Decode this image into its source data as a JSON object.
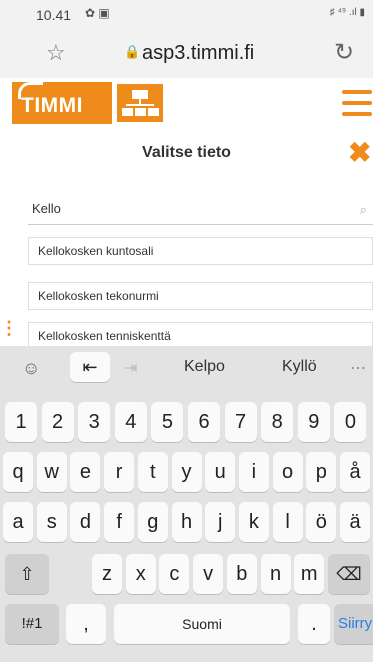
{
  "status": {
    "time": "10.41",
    "left_icons": "✿ ▣",
    "right_icons": "♯ ⁴⁹ .ıl ▮"
  },
  "browser": {
    "url": "asp3.timmi.fi"
  },
  "app": {
    "logo_text": "TIMMI",
    "accent": "#ef8b1a"
  },
  "dialog": {
    "title": "Valitse tieto",
    "search_value": "Kello",
    "options": [
      "Kellokosken kuntosali",
      "Kellokosken tekonurmi",
      "Kellokosken tenniskenttä"
    ]
  },
  "keyboard": {
    "suggestions": [
      "Kelpo",
      "Kyllö"
    ],
    "row1": [
      "1",
      "2",
      "3",
      "4",
      "5",
      "6",
      "7",
      "8",
      "9",
      "0"
    ],
    "row2": [
      "q",
      "w",
      "e",
      "r",
      "t",
      "y",
      "u",
      "i",
      "o",
      "p",
      "å"
    ],
    "row3": [
      "a",
      "s",
      "d",
      "f",
      "g",
      "h",
      "j",
      "k",
      "l",
      "ö",
      "ä"
    ],
    "row4": [
      "z",
      "x",
      "c",
      "v",
      "b",
      "n",
      "m"
    ],
    "symbols_label": "!#1",
    "comma": ",",
    "space_label": "Suomi",
    "period": ".",
    "action_label": "Siirry"
  }
}
